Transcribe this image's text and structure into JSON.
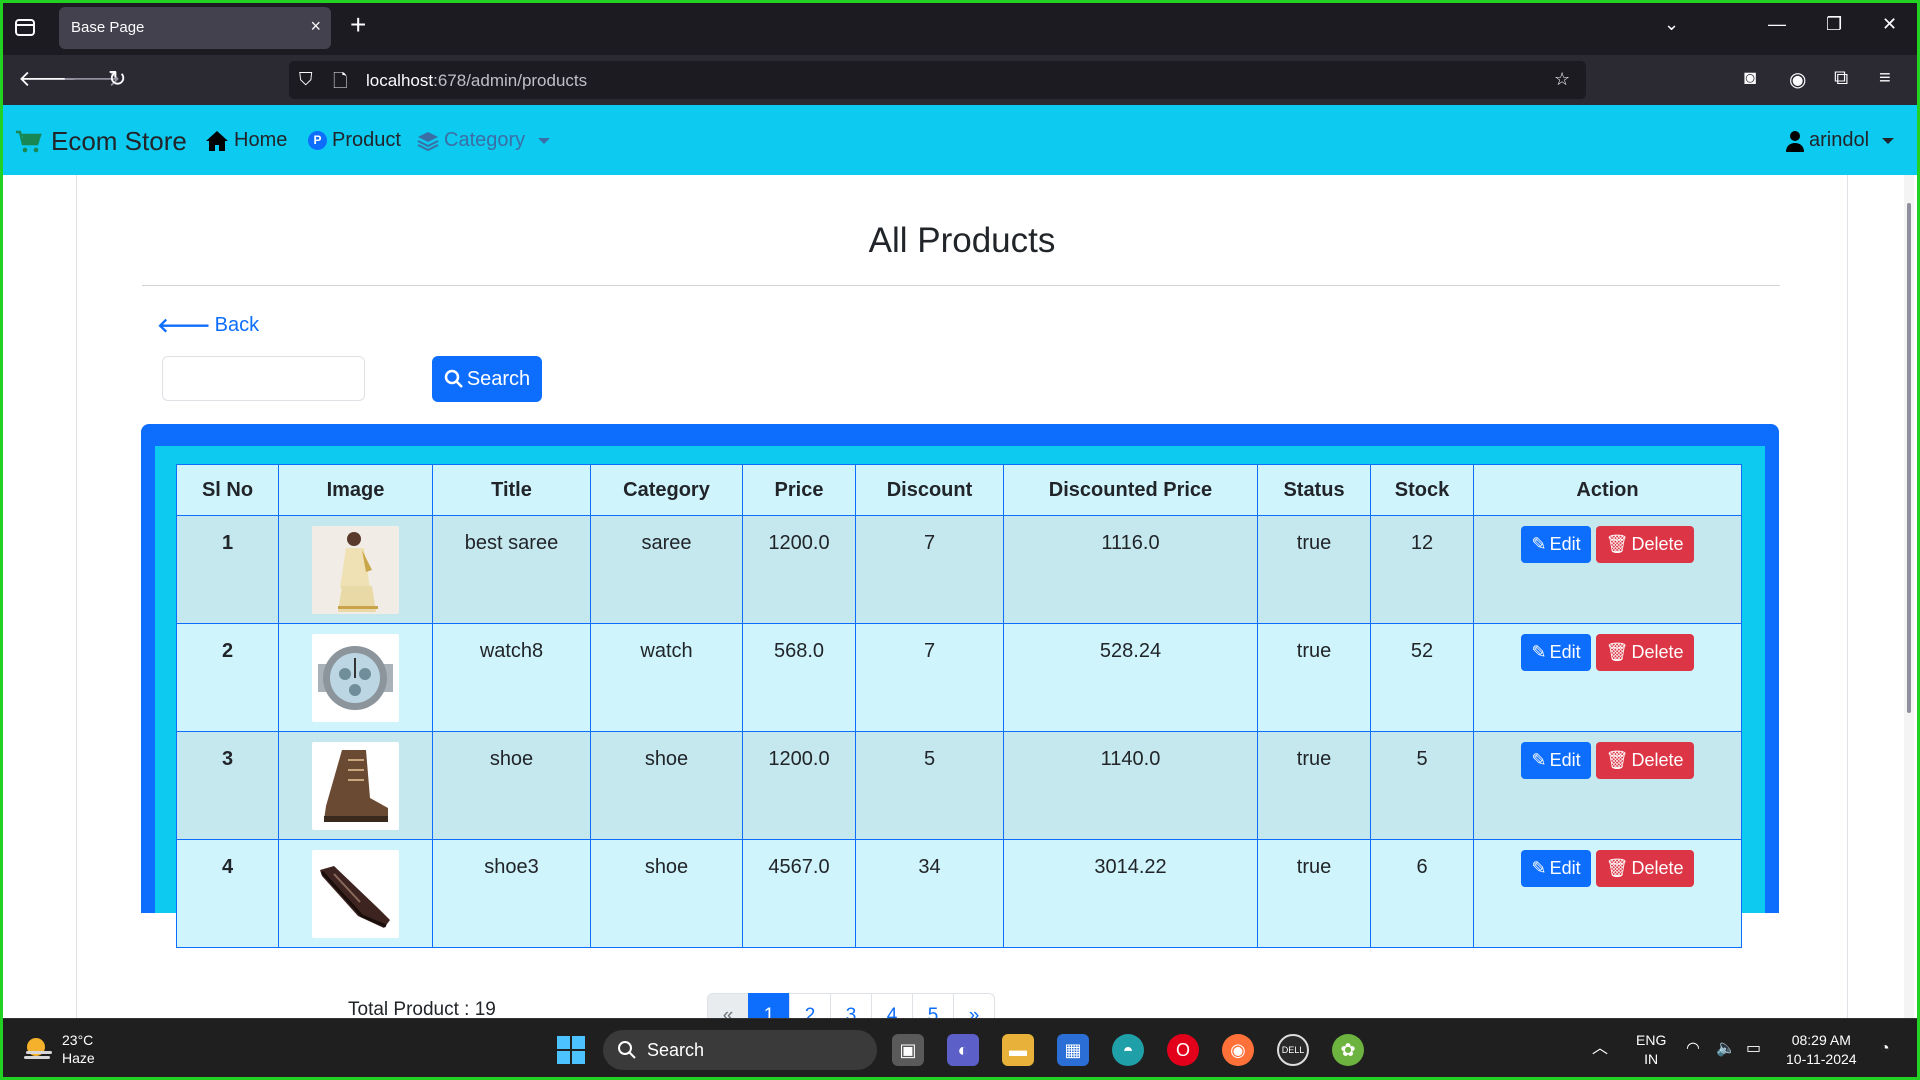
{
  "browser": {
    "tab_title": "Base Page",
    "tab_close": "×",
    "new_tab": "+",
    "url_host": "localhost",
    "url_rest": ":678/admin/products",
    "controls": {
      "list": "⌄",
      "minimize": "—",
      "restore": "❐",
      "close": "✕"
    }
  },
  "site": {
    "brand": "Ecom Store",
    "nav": {
      "home": "Home",
      "product": "Product",
      "category": "Category"
    },
    "user": "arindol",
    "colors": {
      "navbar": "#0dcaf0",
      "primary": "#0d6efd",
      "danger": "#dc3545"
    }
  },
  "main": {
    "title": "All Products",
    "back_label": "Back",
    "search": {
      "value": "",
      "placeholder": "",
      "button": "Search"
    },
    "columns": [
      "Sl No",
      "Image",
      "Title",
      "Category",
      "Price",
      "Discount",
      "Discounted Price",
      "Status",
      "Stock",
      "Action"
    ],
    "rows": [
      {
        "sl": "1",
        "image": "saree-photo",
        "title": "best saree",
        "category": "saree",
        "price": "1200.0",
        "discount": "7",
        "discounted": "1116.0",
        "status": "true",
        "stock": "12"
      },
      {
        "sl": "2",
        "image": "watch-photo",
        "title": "watch8",
        "category": "watch",
        "price": "568.0",
        "discount": "7",
        "discounted": "528.24",
        "status": "true",
        "stock": "52"
      },
      {
        "sl": "3",
        "image": "boot-photo",
        "title": "shoe",
        "category": "shoe",
        "price": "1200.0",
        "discount": "5",
        "discounted": "1140.0",
        "status": "true",
        "stock": "5"
      },
      {
        "sl": "4",
        "image": "dress-shoe-photo",
        "title": "shoe3",
        "category": "shoe",
        "price": "4567.0",
        "discount": "34",
        "discounted": "3014.22",
        "status": "true",
        "stock": "6"
      }
    ],
    "edit_label": "Edit",
    "delete_label": "Delete",
    "total_text": "Total Product : 19",
    "pagination": {
      "prev": "«",
      "pages": [
        "1",
        "2",
        "3",
        "4",
        "5"
      ],
      "next": "»",
      "active": "1"
    }
  },
  "taskbar": {
    "weather_temp": "23°C",
    "weather_desc": "Haze",
    "search_label": "Search",
    "lang": "ENG",
    "region": "IN",
    "time": "08:29 AM",
    "date": "10-11-2024"
  }
}
